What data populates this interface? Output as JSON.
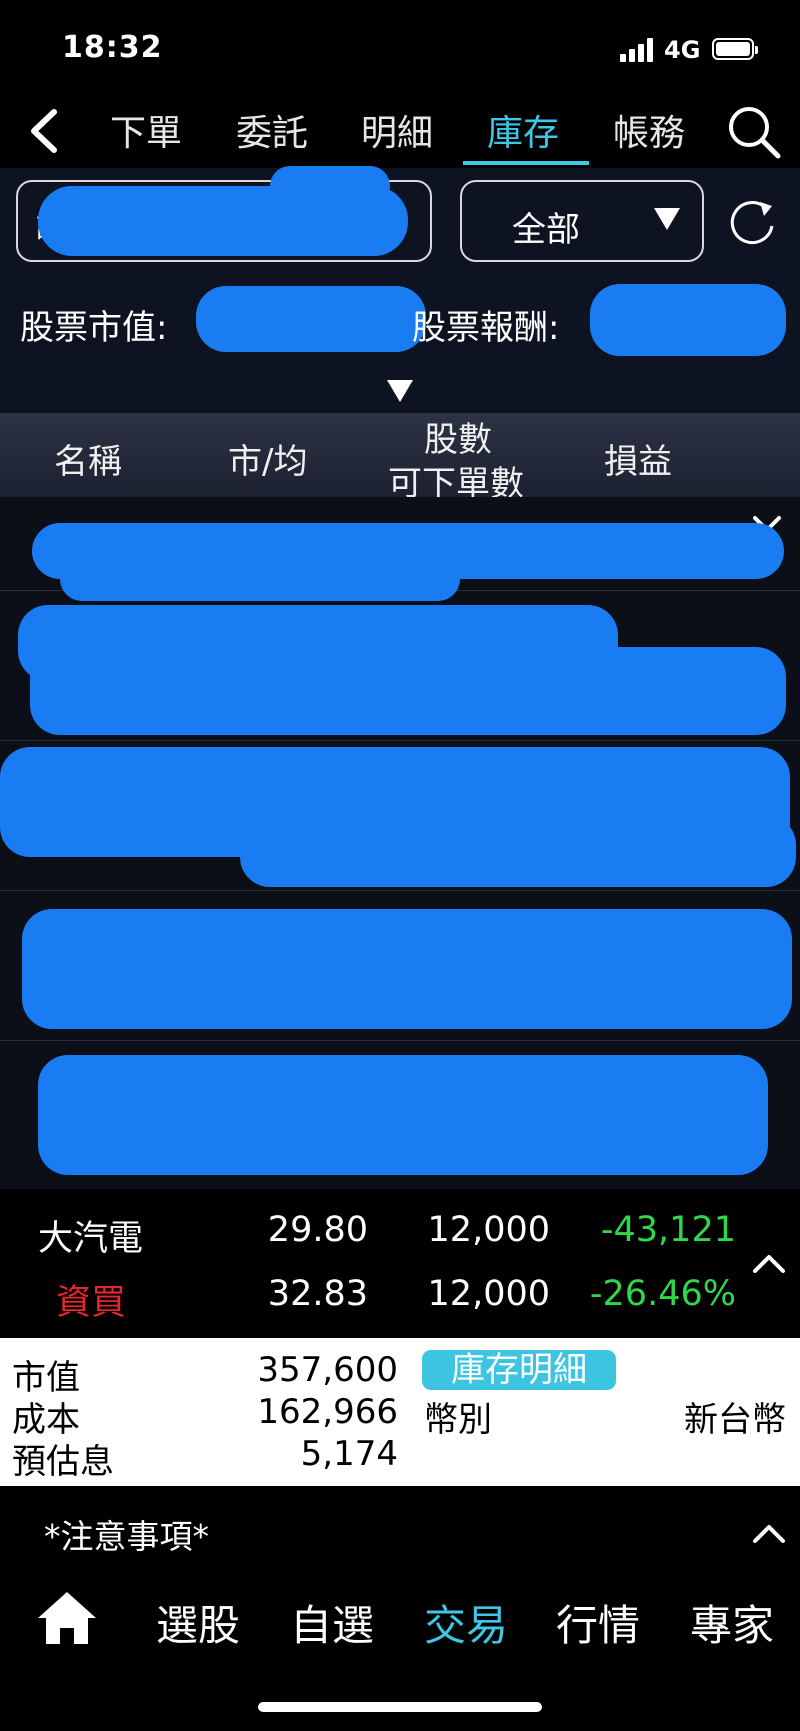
{
  "status_bar": {
    "time": "18:32",
    "network": "4G"
  },
  "top_tabs": [
    {
      "label": "下單",
      "active": false
    },
    {
      "label": "委託",
      "active": false
    },
    {
      "label": "明細",
      "active": false
    },
    {
      "label": "庫存",
      "active": true
    },
    {
      "label": "帳務",
      "active": false
    }
  ],
  "filters": {
    "account_prefix": "證",
    "scope": "全部"
  },
  "summary": {
    "market_value_label": "股票市值:",
    "return_label": "股票報酬:"
  },
  "columns": {
    "name": "名稱",
    "price_avg": "市/均",
    "shares": "股數",
    "orderable": "可下單數",
    "pnl": "損益"
  },
  "last_row": {
    "name": "大汽電",
    "type": "資買",
    "market_price": "29.80",
    "avg_price": "32.83",
    "shares": "12,000",
    "orderable": "12,000",
    "pnl": "-43,121",
    "pnl_pct": "-26.46%"
  },
  "detail": {
    "market_value_label": "市值",
    "market_value": "357,600",
    "cost_label": "成本",
    "cost": "162,966",
    "est_interest_label": "預估息",
    "est_interest": "5,174",
    "button_label": "庫存明細",
    "currency_label": "幣別",
    "currency": "新台幣"
  },
  "notice": "*注意事項*",
  "bottom_nav": [
    {
      "label": "選股",
      "active": false
    },
    {
      "label": "自選",
      "active": false
    },
    {
      "label": "交易",
      "active": true
    },
    {
      "label": "行情",
      "active": false
    },
    {
      "label": "專家",
      "active": false
    }
  ],
  "colors": {
    "accent": "#3fc7e6",
    "loss": "#2fd84a",
    "buy": "#e8242c",
    "redaction": "#1a7cf2"
  }
}
